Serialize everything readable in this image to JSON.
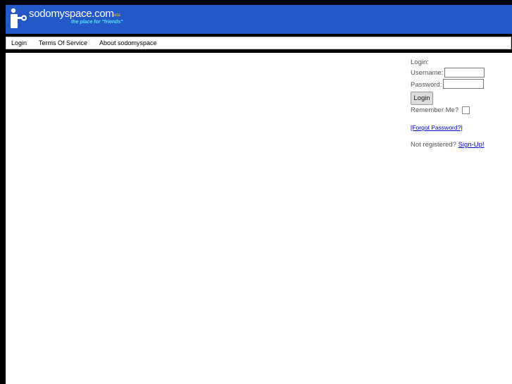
{
  "header": {
    "site_name": "sodomyspace.com",
    "badge": "beta",
    "tagline": "the place for \"friends\"",
    "colors": {
      "background": "#2458c7",
      "tagline": "#55e3ff",
      "badge": "#f2b636"
    }
  },
  "nav": {
    "items": [
      {
        "label": "Login"
      },
      {
        "label": "Terms Of Service"
      },
      {
        "label": "About sodomyspace"
      }
    ]
  },
  "login": {
    "heading": "Login:",
    "username_label": "Username:",
    "username_value": "",
    "password_label": "Password:",
    "password_value": "",
    "button_label": "Login",
    "remember_label": "Remember Me?",
    "remember_checked": false,
    "forgot_link": "[Forgot Password?]",
    "register_prompt": "Not registered?",
    "signup_link": "Sign-Up!"
  }
}
